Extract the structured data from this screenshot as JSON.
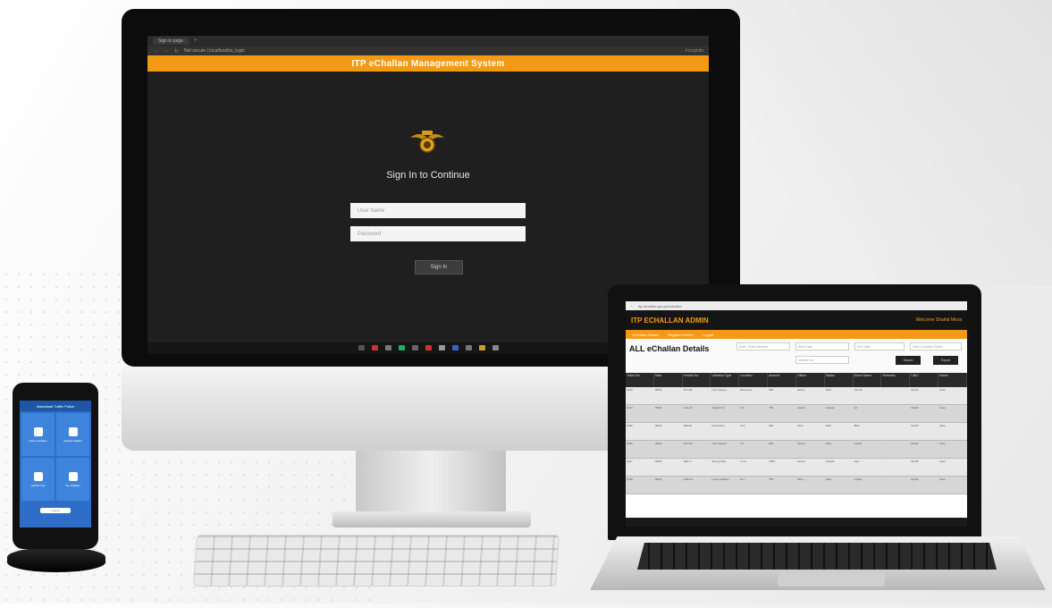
{
  "imac": {
    "browser": {
      "tab_label": "Sign in page",
      "url": "Not secure | localhost/ss_login",
      "right_info": "Incognito"
    },
    "header_title": "ITP eChallan Management System",
    "signin_title": "Sign In to Continue",
    "username_placeholder": "User Name",
    "password_placeholder": "Password",
    "signin_button": "Sign In"
  },
  "laptop": {
    "url": "itp.echallan.gov.pk/echallan",
    "brand": "ITP ECHALLAN ADMIN",
    "user_label": "Welcome Shahid Mirza",
    "nav": [
      "eChallan Details",
      "Register Vehicle",
      "Logout"
    ],
    "page_title": "ALL eChallan Details",
    "filters": [
      "Enter Ticket Number",
      "Start Date",
      "End Date",
      "Select Challan Status",
      "Vehicle No"
    ],
    "buttons": [
      "Search",
      "Export"
    ],
    "columns": [
      "Ticket No",
      "Date",
      "Vehicle No",
      "Violation Type",
      "Location",
      "Amount",
      "Officer",
      "Status",
      "Driver Name",
      "Remarks",
      "CNIC",
      "Action"
    ],
    "rows": [
      [
        "1023",
        "05/02",
        "ICT-AB",
        "Over Speed",
        "Blue Area",
        "500",
        "Akram",
        "Paid",
        "Usman",
        "-",
        "61101",
        "View"
      ],
      [
        "1024",
        "05/02",
        "LEA-22",
        "Signal Cut",
        "F-6",
        "750",
        "Hamid",
        "Unpaid",
        "Ali",
        "-",
        "61102",
        "View"
      ],
      [
        "1025",
        "05/02",
        "RIB-90",
        "No Helmet",
        "G-9",
        "300",
        "Tariq",
        "Paid",
        "Bilal",
        "-",
        "61103",
        "View"
      ],
      [
        "1026",
        "06/02",
        "ICT-CD",
        "Over Speed",
        "I-8",
        "500",
        "Akram",
        "Paid",
        "Kashif",
        "-",
        "61104",
        "View"
      ],
      [
        "1027",
        "06/02",
        "ISB-77",
        "Wrong Way",
        "F-10",
        "1000",
        "Hamid",
        "Unpaid",
        "Zain",
        "-",
        "61105",
        "View"
      ],
      [
        "1028",
        "06/02",
        "LHR-15",
        "Lane Violation",
        "E-7",
        "750",
        "Tariq",
        "Paid",
        "Fahad",
        "-",
        "61106",
        "View"
      ]
    ]
  },
  "phone": {
    "header": "Islamabad Traffic Police",
    "tiles": [
      "Issue eChallan",
      "Search Challan",
      "Vehicle Info",
      "My Challans"
    ],
    "button": "Logout"
  },
  "colors": {
    "accent": "#f39a15",
    "phone_blue": "#2e6ec8"
  }
}
